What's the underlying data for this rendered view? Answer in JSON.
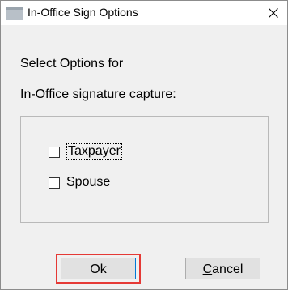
{
  "window": {
    "title": "In-Office Sign Options"
  },
  "prompt": {
    "line1": "Select Options for",
    "line2": "In-Office signature capture:"
  },
  "options": [
    {
      "label": "Taxpayer",
      "checked": false
    },
    {
      "label": "Spouse",
      "checked": false
    }
  ],
  "buttons": {
    "ok_label": "Ok",
    "cancel_label": "Cancel"
  },
  "colors": {
    "highlight": "#e53935",
    "focus": "#0078d7"
  },
  "icons": {
    "app": "window-icon",
    "close": "close-icon"
  }
}
